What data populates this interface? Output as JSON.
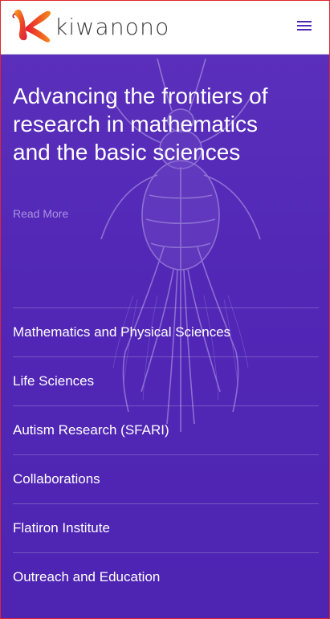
{
  "header": {
    "logo_text": "kiwanono",
    "menu_icon": "hamburger-menu-icon"
  },
  "hero": {
    "headline": "Advancing the frontiers of research in mathematics and the basic sciences",
    "read_more": "Read More",
    "background_image": "insect-xray-illustration"
  },
  "nav": {
    "items": [
      {
        "label": "Mathematics and Physical Sciences"
      },
      {
        "label": "Life Sciences"
      },
      {
        "label": "Autism Research (SFARI)"
      },
      {
        "label": "Collaborations"
      },
      {
        "label": "Flatiron Institute"
      },
      {
        "label": "Outreach and Education"
      }
    ]
  },
  "colors": {
    "brand_purple": "#5227b6",
    "read_more": "#a991e0",
    "logo_red": "#e0242c",
    "logo_orange": "#f39a1e"
  }
}
